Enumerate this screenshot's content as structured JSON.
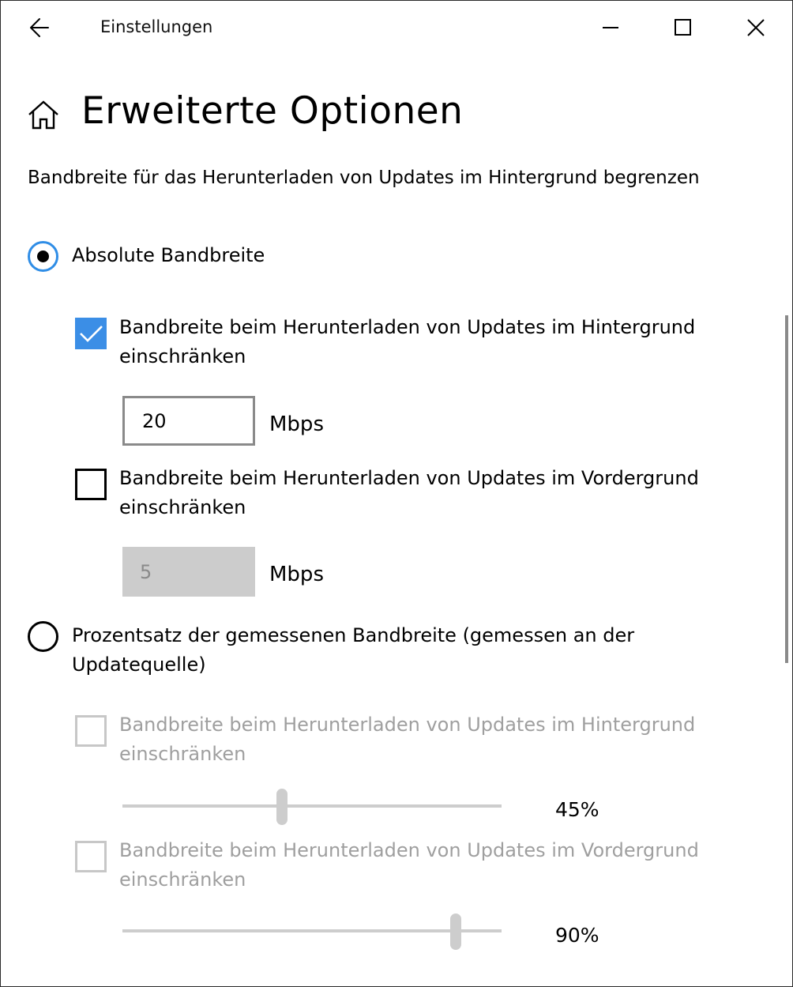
{
  "window": {
    "title": "Einstellungen"
  },
  "header": {
    "title": "Erweiterte Optionen"
  },
  "section": {
    "description": "Bandbreite für das Herunterladen von Updates im Hintergrund begrenzen"
  },
  "absolute": {
    "label": "Absolute Bandbreite",
    "selected": true,
    "background": {
      "label": "Bandbreite beim Herunterladen von Updates im Hintergrund einschränken",
      "checked": true,
      "value": "20",
      "unit": "Mbps"
    },
    "foreground": {
      "label": "Bandbreite beim Herunterladen von Updates im Vordergrund einschränken",
      "checked": false,
      "value": "5",
      "unit": "Mbps"
    }
  },
  "percentage": {
    "label": "Prozentsatz der gemessenen Bandbreite (gemessen an der Updatequelle)",
    "selected": false,
    "background": {
      "label": "Bandbreite beim Herunterladen von Updates im Hintergrund einschränken",
      "checked": false,
      "level": 0.42,
      "value_text": "45%"
    },
    "foreground": {
      "label": "Bandbreite beim Herunterladen von Updates im Vordergrund einschränken",
      "checked": false,
      "level": 0.88,
      "value_text": "90%"
    }
  },
  "icons": [
    "back-arrow-icon",
    "minimize-icon",
    "maximize-icon",
    "close-icon",
    "home-icon",
    "checkmark-icon"
  ],
  "colors": {
    "accent": "#3b8ee6",
    "disabled": "#cccccc"
  }
}
